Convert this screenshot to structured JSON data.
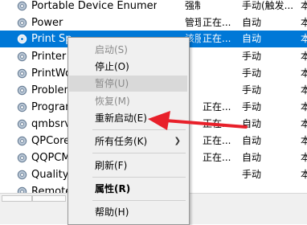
{
  "services": [
    {
      "name": "Portable Device Enumera...",
      "desc": "强制...",
      "status": "",
      "startup": "手动(触发...",
      "logon": "本"
    },
    {
      "name": "Power",
      "desc": "管理...",
      "status": "正在...",
      "startup": "自动",
      "logon": "本"
    },
    {
      "name": "Print Sp...",
      "desc": "该服...",
      "status": "正在...",
      "startup": "自动",
      "logon": "本"
    },
    {
      "name": "Printer",
      "desc": "",
      "status": "",
      "startup": "手动",
      "logon": "本"
    },
    {
      "name": "PrintWo...",
      "desc": "",
      "status": "",
      "startup": "手动",
      "logon": "本"
    },
    {
      "name": "Problem...",
      "desc": "",
      "status": "",
      "startup": "手动",
      "logon": "本"
    },
    {
      "name": "Program...",
      "desc": "",
      "status": "正在...",
      "startup": "手动",
      "logon": "本"
    },
    {
      "name": "qmbsrv...",
      "desc": "",
      "status": "正在...",
      "startup": "自动",
      "logon": "本"
    },
    {
      "name": "QPCore...",
      "desc": "",
      "status": "正在...",
      "startup": "自动",
      "logon": "本"
    },
    {
      "name": "QQPCM...",
      "desc": "",
      "status": "正在...",
      "startup": "自动",
      "logon": "本"
    },
    {
      "name": "Quality...",
      "desc": "",
      "status": "",
      "startup": "手动",
      "logon": "本"
    },
    {
      "name": "Remote...",
      "desc": "",
      "status": "",
      "startup": "",
      "logon": ""
    }
  ],
  "context_menu": {
    "start": "启动(S)",
    "stop": "停止(O)",
    "pause": "暂停(U)",
    "resume": "恢复(M)",
    "restart": "重新启动(E)",
    "all_tasks": "所有任务(K)",
    "refresh": "刷新(F)",
    "properties": "属性(R)",
    "help": "帮助(H)"
  },
  "colors": {
    "selection": "#0078d7",
    "annotation_arrow": "#e8202a"
  }
}
